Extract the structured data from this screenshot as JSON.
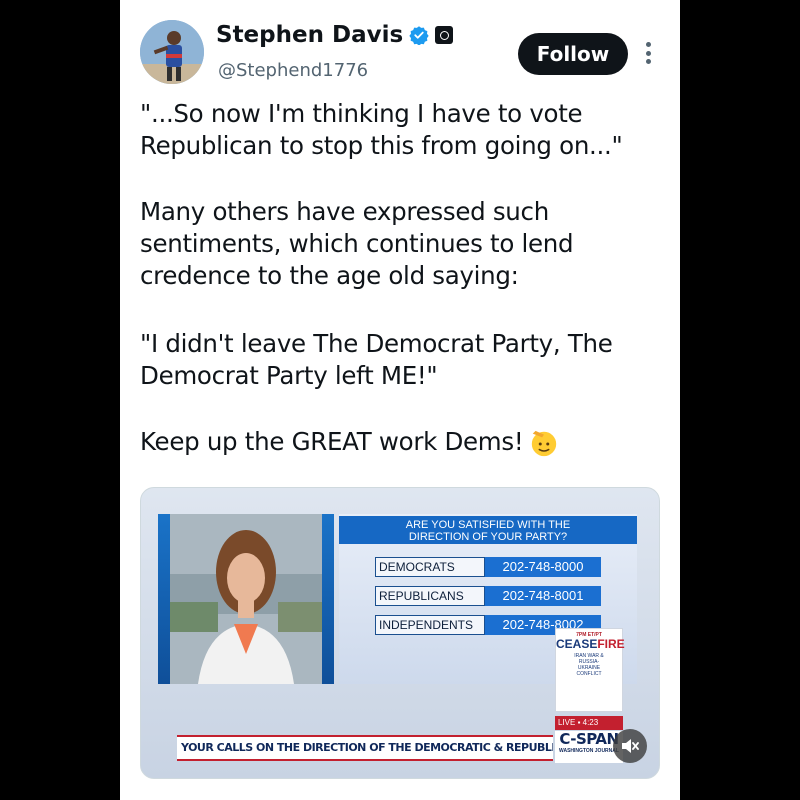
{
  "post": {
    "author_name": "Stephen Davis",
    "author_handle": "@Stephend1776",
    "follow_label": "Follow",
    "text": {
      "p1_line1": "\"...So now I'm thinking I have to vote",
      "p1_line2": "Republican to stop this from going on...\"",
      "p2_line1": "Many others have expressed such",
      "p2_line2": "sentiments, which continues to lend",
      "p2_line3": "credence to the age old saying:",
      "p3_line1": "\"I didn't leave The Democrat Party, The",
      "p3_line2": "Democrat Party left ME!\"",
      "p4": "Keep up the GREAT work Dems!"
    },
    "emoji_icon": "saluting-face-emoji"
  },
  "media": {
    "poll_question_line1": "ARE YOU SATISFIED WITH THE",
    "poll_question_line2": "DIRECTION OF YOUR PARTY?",
    "rows": [
      {
        "label": "DEMOCRATS",
        "number": "202-748-8000"
      },
      {
        "label": "REPUBLICANS",
        "number": "202-748-8001"
      },
      {
        "label": "INDEPENDENTS",
        "number": "202-748-8002"
      }
    ],
    "ceasefire": {
      "time": "7PM ET/PT",
      "title_a": "CEASE",
      "title_b": "FIRE",
      "line1": "IRAN WAR &",
      "line2": "RUSSIA-",
      "line3": "UKRAINE",
      "line4": "CONFLICT"
    },
    "live_label": "LIVE",
    "live_time": "4:23",
    "network": "C-SPAN",
    "network_sub": "WASHINGTON JOURNAL",
    "lower_third": "YOUR CALLS ON THE DIRECTION OF THE DEMOCRATIC & REPUBLICAN PARTIES",
    "colors": {
      "accent_blue": "#1b6fd1",
      "accent_red": "#c3202f",
      "navy": "#10285a"
    }
  }
}
